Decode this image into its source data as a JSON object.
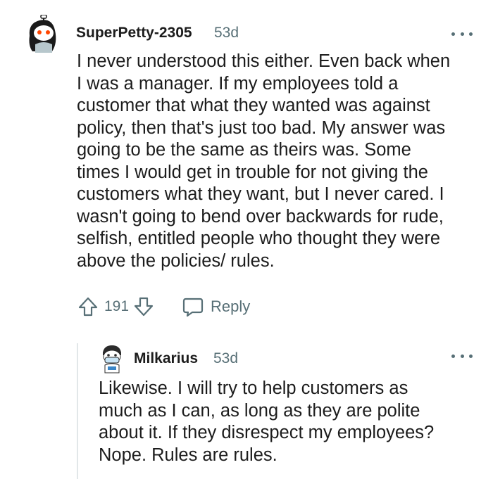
{
  "comment": {
    "author": "SuperPetty-2305",
    "age": "53d",
    "lines": [
      "I never understood this either. Even back when",
      "I was a manager. If my employees told a",
      "customer that what they wanted was against",
      "policy, then that's just too bad. My answer was",
      "going to be the same as theirs was. Some",
      "times I would get in trouble for not giving the",
      "customers what they want, but I never cared. I",
      "wasn't going to bend over backwards for rude,",
      "selfish, entitled people who thought they were",
      "above the policies/ rules."
    ],
    "score": "191",
    "reply_label": "Reply",
    "icons": [
      "upvote-icon",
      "downvote-icon",
      "comment-bubble-icon",
      "more-options-icon"
    ]
  },
  "reply": {
    "author": "Milkarius",
    "age": "53d",
    "lines": [
      "Likewise. I will try to help customers as",
      "much as I can, as long as they are polite",
      "about it. If they disrespect my employees?",
      "Nope. Rules are rules."
    ]
  },
  "colors": {
    "text": "#1c1c1c",
    "meta": "#576f76",
    "thread_line": "#e2e7e9"
  }
}
